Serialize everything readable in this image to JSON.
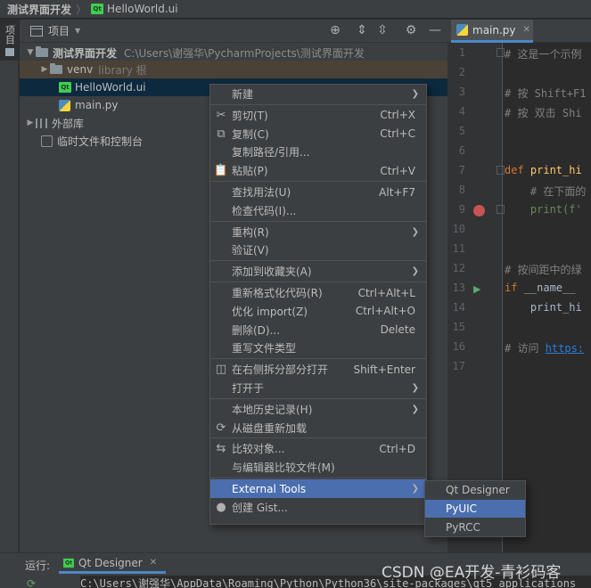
{
  "breadcrumb": {
    "project": "测试界面开发",
    "file": "HelloWorld.ui"
  },
  "left_stripe": {
    "project_label": "项目"
  },
  "project_panel": {
    "title": "项目",
    "tree": {
      "root": {
        "name": "测试界面开发",
        "path": "C:\\Users\\谢强华\\PycharmProjects\\测试界面开发"
      },
      "venv": {
        "name": "venv",
        "hint": "library 根"
      },
      "files": [
        "HelloWorld.ui",
        "main.py"
      ],
      "external_libraries": "外部库",
      "scratches": "临时文件和控制台"
    }
  },
  "editor": {
    "tab": "main.py",
    "lines": [
      {
        "n": "1",
        "parts": [
          {
            "t": "# 这是一个示例",
            "c": "comment"
          }
        ]
      },
      {
        "n": "2",
        "parts": []
      },
      {
        "n": "3",
        "parts": [
          {
            "t": "# 按 Shift+F1",
            "c": "comment"
          }
        ]
      },
      {
        "n": "4",
        "parts": [
          {
            "t": "# 按 双击 Shi",
            "c": "comment"
          }
        ]
      },
      {
        "n": "5",
        "parts": []
      },
      {
        "n": "6",
        "parts": []
      },
      {
        "n": "7",
        "parts": [
          {
            "t": "def ",
            "c": "kw"
          },
          {
            "t": "print_hi",
            "c": "fn"
          }
        ]
      },
      {
        "n": "8",
        "parts": [
          {
            "t": "    # 在下面的",
            "c": "comment"
          }
        ]
      },
      {
        "n": "9",
        "parts": [
          {
            "t": "    print(f'",
            "c": "str"
          }
        ]
      },
      {
        "n": "10",
        "parts": []
      },
      {
        "n": "11",
        "parts": []
      },
      {
        "n": "12",
        "parts": [
          {
            "t": "# 按间距中的绿",
            "c": "comment"
          }
        ]
      },
      {
        "n": "13",
        "parts": [
          {
            "t": "if ",
            "c": "kw"
          },
          {
            "t": "__name__ ",
            "c": "plain"
          }
        ]
      },
      {
        "n": "14",
        "parts": [
          {
            "t": "    print_hi",
            "c": "plain"
          }
        ]
      },
      {
        "n": "15",
        "parts": []
      },
      {
        "n": "16",
        "parts": [
          {
            "t": "# 访问 ",
            "c": "comment"
          },
          {
            "t": "https:",
            "c": "link"
          }
        ]
      },
      {
        "n": "17",
        "parts": []
      }
    ]
  },
  "context_menu": {
    "items": [
      {
        "icon": "",
        "label": "新建",
        "shortcut": "",
        "submenu": true
      },
      {
        "sep": true
      },
      {
        "icon": "✂",
        "label": "剪切(T)",
        "shortcut": "Ctrl+X"
      },
      {
        "icon": "⧉",
        "label": "复制(C)",
        "shortcut": "Ctrl+C"
      },
      {
        "icon": "",
        "label": "复制路径/引用...",
        "shortcut": ""
      },
      {
        "icon": "📋",
        "label": "粘贴(P)",
        "shortcut": "Ctrl+V"
      },
      {
        "sep": true
      },
      {
        "icon": "",
        "label": "查找用法(U)",
        "shortcut": "Alt+F7"
      },
      {
        "icon": "",
        "label": "检查代码(I)...",
        "shortcut": ""
      },
      {
        "sep": true
      },
      {
        "icon": "",
        "label": "重构(R)",
        "shortcut": "",
        "submenu": true
      },
      {
        "icon": "",
        "label": "验证(V)",
        "shortcut": ""
      },
      {
        "sep": true
      },
      {
        "icon": "",
        "label": "添加到收藏夹(A)",
        "shortcut": "",
        "submenu": true
      },
      {
        "sep": true
      },
      {
        "icon": "",
        "label": "重新格式化代码(R)",
        "shortcut": "Ctrl+Alt+L"
      },
      {
        "icon": "",
        "label": "优化 import(Z)",
        "shortcut": "Ctrl+Alt+O"
      },
      {
        "icon": "",
        "label": "删除(D)...",
        "shortcut": "Delete"
      },
      {
        "icon": "",
        "label": "重写文件类型",
        "shortcut": ""
      },
      {
        "sep": true
      },
      {
        "icon": "◫",
        "label": "在右侧拆分部分打开",
        "shortcut": "Shift+Enter"
      },
      {
        "icon": "",
        "label": "打开于",
        "shortcut": "",
        "submenu": true
      },
      {
        "sep": true
      },
      {
        "icon": "",
        "label": "本地历史记录(H)",
        "shortcut": "",
        "submenu": true
      },
      {
        "icon": "⟳",
        "label": "从磁盘重新加载",
        "shortcut": ""
      },
      {
        "sep": true
      },
      {
        "icon": "⇆",
        "label": "比较对象...",
        "shortcut": "Ctrl+D"
      },
      {
        "icon": "",
        "label": "与编辑器比较文件(M)",
        "shortcut": ""
      },
      {
        "sep": true
      },
      {
        "icon": "",
        "label": "External Tools",
        "shortcut": "",
        "submenu": true,
        "selected": true
      },
      {
        "icon": "●",
        "label": "创建 Gist...",
        "shortcut": ""
      }
    ]
  },
  "external_tools_submenu": {
    "items": [
      {
        "label": "Qt Designer"
      },
      {
        "label": "PyUIC",
        "selected": true
      },
      {
        "label": "PyRCC"
      }
    ]
  },
  "run_panel": {
    "label": "运行:",
    "tab": "Qt Designer",
    "console_line": "C:\\Users\\谢强华\\AppData\\Roaming\\Python\\Python36\\site-packages\\qt5_applications"
  },
  "watermark": "CSDN @EA开发-青衫码客",
  "colors": {
    "selection": "#4b6eaf",
    "tree_selection": "#0d293e",
    "accent": "#4a88c7"
  }
}
